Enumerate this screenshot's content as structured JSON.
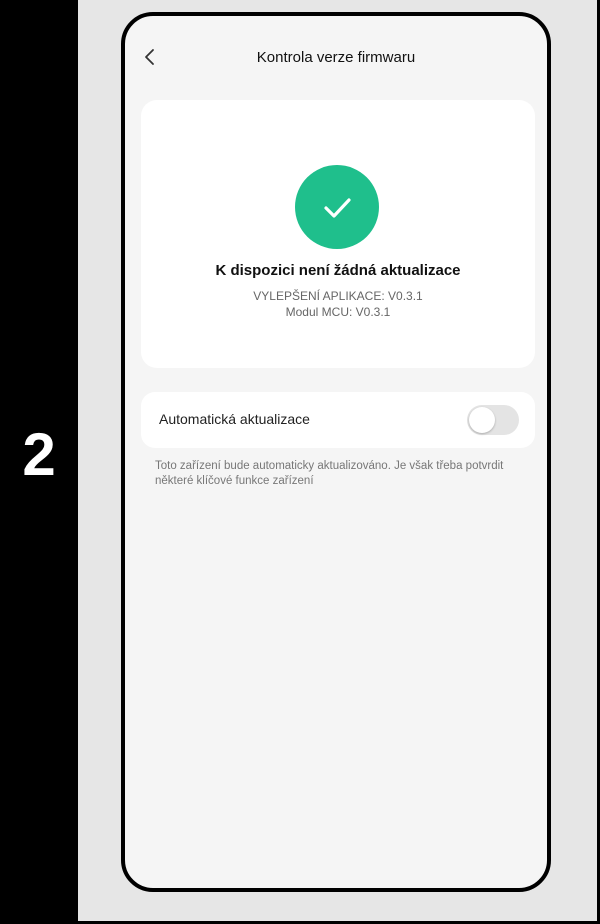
{
  "step": {
    "number": "2"
  },
  "navbar": {
    "title": "Kontrola verze firmwaru",
    "back_icon": "chevron-left-icon"
  },
  "status": {
    "icon": "checkmark-icon",
    "icon_color": "#1fbf8c",
    "title": "K dispozici není žádná aktualizace",
    "app_version_line": "VYLEPŠENÍ APLIKACE: V0.3.1",
    "mcu_version_line": "Modul MCU: V0.3.1"
  },
  "auto_update": {
    "label": "Automatická aktualizace",
    "enabled": false,
    "description": "Toto zařízení bude automaticky aktualizováno. Je však třeba potvrdit některé klíčové funkce zařízení"
  }
}
